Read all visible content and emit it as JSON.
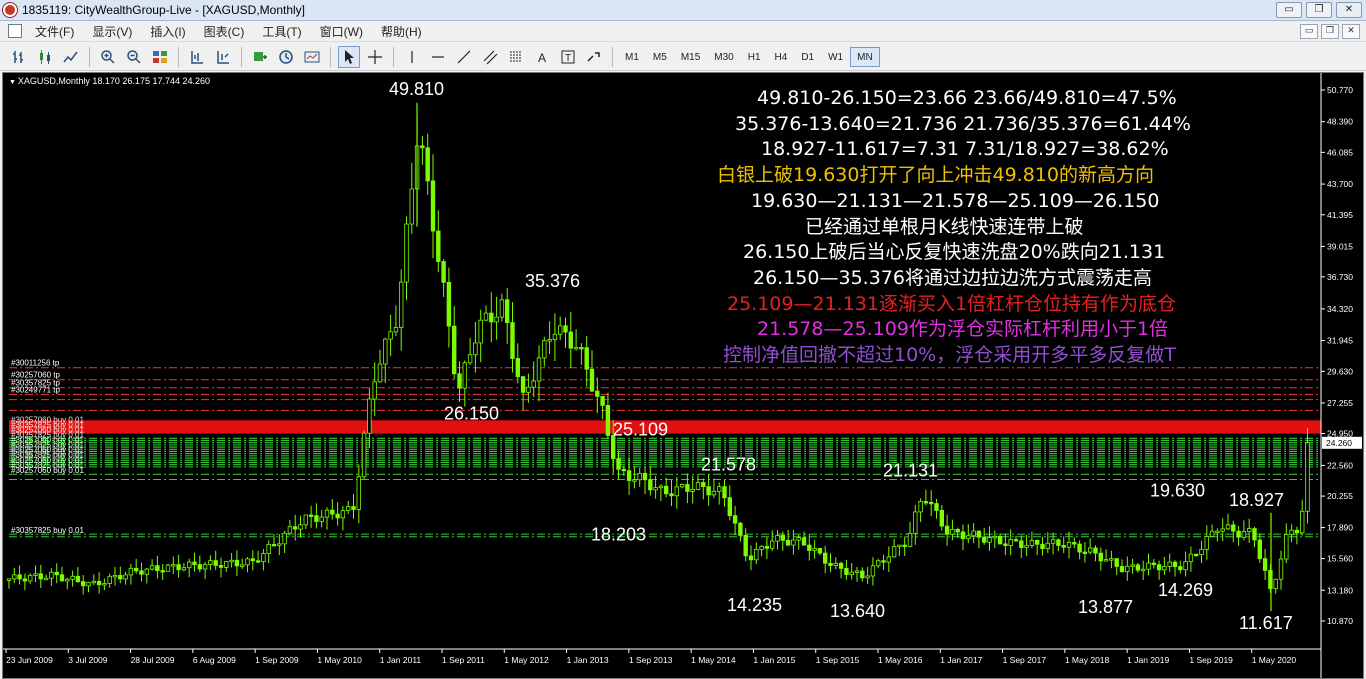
{
  "window": {
    "title": "1835119: CityWealthGroup-Live - [XAGUSD,Monthly]",
    "buttons": [
      "▭",
      "❐",
      "✕"
    ]
  },
  "menu": {
    "items": [
      "文件(F)",
      "显示(V)",
      "插入(I)",
      "图表(C)",
      "工具(T)",
      "窗口(W)",
      "帮助(H)"
    ]
  },
  "toolbar": {
    "timeframes": [
      "M1",
      "M5",
      "M15",
      "M30",
      "H1",
      "H4",
      "D1",
      "W1",
      "MN"
    ],
    "active_timeframe": "MN"
  },
  "chart_label": "XAGUSD,Monthly  18.170 26.175 17.744 24.260",
  "chart_data": {
    "type": "candlestick",
    "symbol": "XAGUSD",
    "timeframe": "Monthly",
    "ohlc_header": {
      "open": 18.17,
      "high": 26.175,
      "low": 17.744,
      "close": 24.26
    },
    "current_price_label": "24.260",
    "y_axis": {
      "range": [
        10.87,
        50.77
      ],
      "tick_labels": [
        "50.770",
        "48.390",
        "46.085",
        "43.700",
        "41.395",
        "39.015",
        "36.730",
        "34.320",
        "31.945",
        "29.630",
        "27.255",
        "24.950",
        "22.560",
        "20.255",
        "17.890",
        "15.560",
        "13.180",
        "10.870"
      ]
    },
    "x_axis": {
      "tick_labels": [
        "23 Jun 2009",
        "3 Jul 2009",
        "28 Jul 2009",
        "6 Aug 2009",
        "1 Sep 2009",
        "1 May 2010",
        "1 Jan 2011",
        "1 Sep 2011",
        "1 May 2012",
        "1 Jan 2013",
        "1 Sep 2013",
        "1 May 2014",
        "1 Jan 2015",
        "1 Sep 2015",
        "1 May 2016",
        "1 Jan 2017",
        "1 Sep 2017",
        "1 May 2018",
        "1 Jan 2019",
        "1 Sep 2019",
        "1 May 2020"
      ]
    },
    "price_labels": [
      {
        "text": "49.810",
        "value": 49.81
      },
      {
        "text": "35.376",
        "value": 35.376
      },
      {
        "text": "26.150",
        "value": 26.15
      },
      {
        "text": "25.109",
        "value": 25.109
      },
      {
        "text": "21.578",
        "value": 21.578
      },
      {
        "text": "18.203",
        "value": 18.203
      },
      {
        "text": "21.131",
        "value": 21.131
      },
      {
        "text": "14.235",
        "value": 14.235
      },
      {
        "text": "13.640",
        "value": 13.64
      },
      {
        "text": "13.877",
        "value": 13.877
      },
      {
        "text": "14.269",
        "value": 14.269
      },
      {
        "text": "19.630",
        "value": 19.63
      },
      {
        "text": "18.927",
        "value": 18.927
      },
      {
        "text": "11.617",
        "value": 11.617
      }
    ],
    "order_lines": {
      "tp_labels": [
        "#30011256 tp",
        "#30257060 tp",
        "#30357825 tp",
        "#30249771 tp"
      ],
      "buy_labels": [
        "#30257060 buy 0.01",
        "#30357825 buy 0.01"
      ],
      "tp_levels": [
        29.9,
        29.0,
        28.4,
        27.9,
        27.5,
        26.7
      ],
      "buy_low_levels": [
        21.9,
        21.5,
        17.4,
        17.2
      ],
      "red_band": [
        24.95,
        25.95
      ],
      "green_band": [
        22.3,
        24.6
      ]
    }
  },
  "annotations": [
    {
      "text": "49.810-26.150=23.66  23.66/49.810=47.5%",
      "color": "#ffffff"
    },
    {
      "text": "35.376-13.640=21.736   21.736/35.376=61.44%",
      "color": "#ffffff"
    },
    {
      "text": "18.927-11.617=7.31   7.31/18.927=38.62%",
      "color": "#ffffff"
    },
    {
      "text": "白银上破19.630打开了向上冲击49.810的新高方向",
      "color": "#f0c000"
    },
    {
      "text": "19.630—21.131—21.578—25.109—26.150",
      "color": "#ffffff"
    },
    {
      "text": "已经通过单根月K线快速连带上破",
      "color": "#ffffff"
    },
    {
      "text": "26.150上破后当心反复快速洗盘20%跌向21.131",
      "color": "#ffffff"
    },
    {
      "text": "26.150—35.376将通过边拉边洗方式震荡走高",
      "color": "#ffffff"
    },
    {
      "text": "25.109—21.131逐渐买入1倍杠杆仓位持有作为底仓",
      "color": "#e62020"
    },
    {
      "text": "21.578—25.109作为浮仓实际杠杆利用小于1倍",
      "color": "#e030e0"
    },
    {
      "text": "控制净值回撤不超过10%，浮仓采用开多平多反复做T",
      "color": "#9050d0"
    }
  ],
  "colors": {
    "chart_bg": "#000000",
    "candle": "#7cfc00",
    "tp_line": "#ff3030",
    "buy_line": "#33cc33",
    "price_tag_bg": "#ffffff"
  }
}
